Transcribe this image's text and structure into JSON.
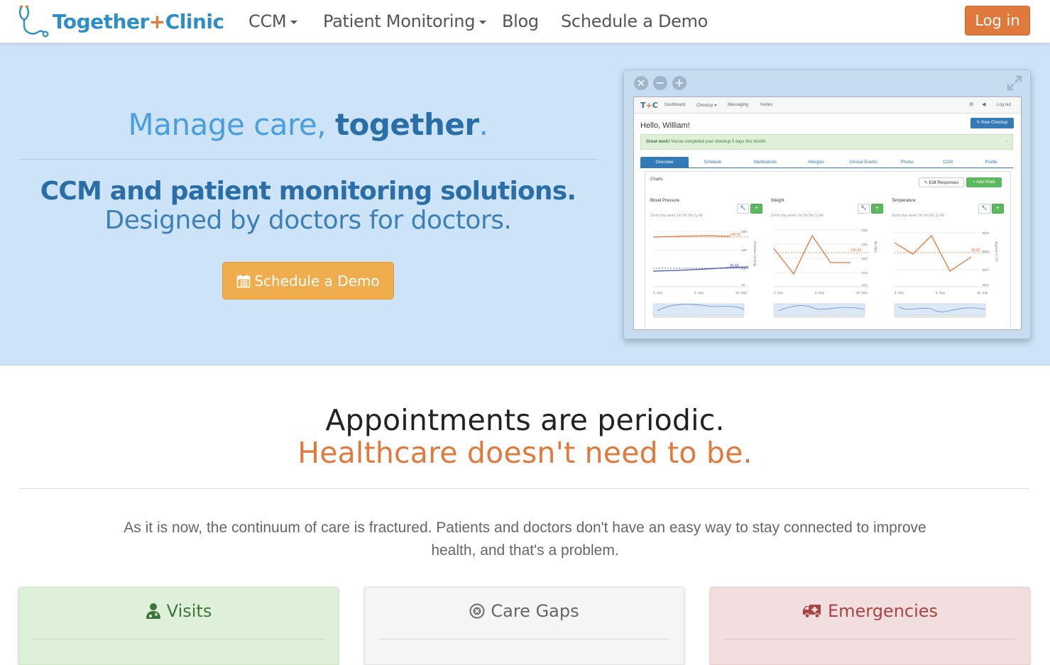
{
  "nav": {
    "brand_left": "Together",
    "brand_plus": "+",
    "brand_right": "Clinic",
    "items": [
      {
        "label": "CCM",
        "dropdown": true
      },
      {
        "label": "Patient Monitoring",
        "dropdown": true
      },
      {
        "label": "Blog",
        "dropdown": false
      },
      {
        "label": "Schedule a Demo",
        "dropdown": false
      }
    ],
    "login_label": "Log in"
  },
  "hero": {
    "title_light": "Manage care, ",
    "title_bold": "together",
    "title_end": ".",
    "subtitle_1": "CCM and patient monitoring solutions.",
    "subtitle_2": "Designed by doctors for doctors.",
    "cta_label": "Schedule a Demo",
    "cta_icon": "calendar-icon"
  },
  "app_preview": {
    "brand_left": "T",
    "brand_plus": "+",
    "brand_right": "C",
    "nav_links": [
      "Dashboard",
      "Checkup ▾",
      "Messaging",
      "Invites"
    ],
    "logout": "Log out",
    "greeting": "Hello, William!",
    "new_checkup": "✎ New Checkup",
    "alert_bold": "Great work!",
    "alert_text": " You've completed your checkup 5 days this month.",
    "alert_close": "×",
    "tabs": [
      "Overview",
      "Schedule",
      "Medications",
      "Allergies",
      "Clinical Events",
      "Photos",
      "CCM",
      "Profile"
    ],
    "charts_label": "Charts",
    "edit_responses": "✎ Edit Responses",
    "add_vitals": "+ Add Vitals",
    "zoom_label": "Zoom  day  week  1m  3m  6m  1y  All",
    "minicharts": [
      {
        "title": "Blood Pressure",
        "ylabel": "Pressure (mmHg)",
        "ticks": [
          "150",
          "125",
          "100",
          "75"
        ],
        "labels": [
          "146.60",
          "96.60"
        ],
        "x": [
          "4. Sep",
          "6. Sep",
          "10. Sep"
        ]
      },
      {
        "title": "Weight",
        "ylabel": "lbs (lbs)",
        "ticks": [
          "216",
          "215",
          "214",
          "213",
          "212"
        ],
        "labels": [
          "214.40"
        ],
        "x": [
          "4. Sep",
          "6. Sep",
          "10. Sep"
        ]
      },
      {
        "title": "Temperature",
        "ylabel": "degrees F (°F)",
        "ticks": [
          "98.9",
          "98.8",
          "98.7",
          "98.6"
        ],
        "labels": [
          "98.82"
        ],
        "x": [
          "4. Sep",
          "6. Sep",
          "10. Sep"
        ]
      }
    ]
  },
  "section": {
    "title": "Appointments are periodic.",
    "subtitle": "Healthcare doesn't need to be.",
    "paragraph": "As it is now, the continuum of care is fractured. Patients and doctors don't have an easy way to stay connected to improve health, and that's a problem."
  },
  "cards": [
    {
      "label": "Visits",
      "icon": "user-md-icon",
      "color": "#3c763d"
    },
    {
      "label": "Care Gaps",
      "icon": "times-circle-icon",
      "color": "#666666"
    },
    {
      "label": "Emergencies",
      "icon": "ambulance-icon",
      "color": "#a94442"
    }
  ],
  "colors": {
    "accent": "#e07a3c",
    "brand_blue": "#2d8ec9",
    "hero_bg": "#cde4f8",
    "cta": "#f0ad4e"
  }
}
